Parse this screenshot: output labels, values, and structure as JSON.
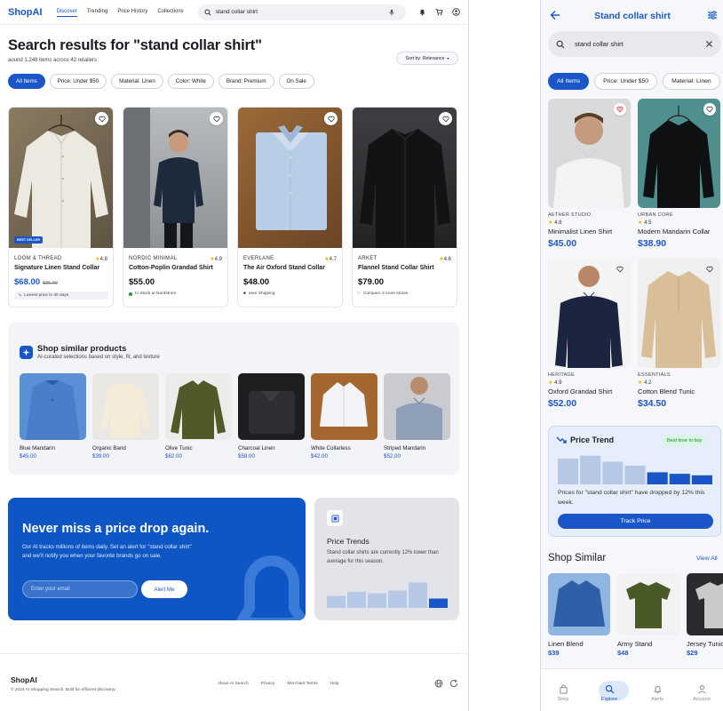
{
  "desktop": {
    "logo": "ShopAI",
    "nav": [
      "Discover",
      "Trending",
      "Price History",
      "Collections"
    ],
    "search_value": "stand collar shirt",
    "page_title": "Search results for \"stand collar shirt\"",
    "subtitle": "aound 1,248 items across 42 retailers",
    "sort_label": "Sort by: Relevance",
    "chips": [
      "All Items",
      "Price: Under $50",
      "Material: Linen",
      "Color: White",
      "Brand: Premium",
      "On Sale"
    ],
    "products": [
      {
        "brand": "LOOM & THREAD",
        "rating": "4.8",
        "name": "Signature Linen Stand Collar",
        "price": "$68.00",
        "old_price": "$85.00",
        "badge": "BEST SELLER",
        "note": "Lowest price in 30 days"
      },
      {
        "brand": "NORDIC MINIMAL",
        "rating": "4.9",
        "name": "Cotton-Poplin Grandad Shirt",
        "price": "$55.00",
        "note": "In Stock at Nordstrom"
      },
      {
        "brand": "EVERLANE",
        "rating": "4.7",
        "name": "The Air Oxford Stand Collar",
        "price": "$48.00",
        "note": "aree Shipping"
      },
      {
        "brand": "ARKET",
        "rating": "4.6",
        "name": "Flannel Stand Collar Shirt",
        "price": "$79.00",
        "note": "Compare 3 more stores"
      }
    ],
    "similar": {
      "title": "Shop similar products",
      "subtitle": "AI-curated selections based on style, fit, and texture",
      "items": [
        {
          "name": "Blue Mandarin",
          "price": "$45.00"
        },
        {
          "name": "Organic Band",
          "price": "$39.00"
        },
        {
          "name": "Olive Tunic",
          "price": "$62.00"
        },
        {
          "name": "Charcoal Linen",
          "price": "$58.00"
        },
        {
          "name": "White Collarless",
          "price": "$42.00"
        },
        {
          "name": "Striped Mandarin",
          "price": "$52.00"
        }
      ]
    },
    "alert": {
      "title": "Never miss a price drop again.",
      "body": "Our AI tracks millions of items daily. Set an alert for \"stand collar shirt\" and we'll notify you when your favorite brands go on sale.",
      "email_placeholder": "Enter your email",
      "button": "Alert Me"
    },
    "trends": {
      "title": "Price Trends",
      "body": "Stand collar shirts are currently 12% lower than average for this season.",
      "bars": [
        0.45,
        0.6,
        0.55,
        0.65,
        0.95,
        0.35
      ]
    },
    "footer": {
      "logo": "ShopAI",
      "copyright": "© 2024 AI Shopping Search. Built for efficient discovery.",
      "links": [
        "About AI Search",
        "Privacy",
        "Merchant Terms",
        "Help"
      ]
    }
  },
  "mobile": {
    "title": "Stand collar shirt",
    "search_value": "stand collar shirt",
    "chips": [
      "All Items",
      "Price: Under $50",
      "Material: Linen"
    ],
    "products": [
      {
        "brand": "AETHER STUDIO",
        "rating": "4.8",
        "name": "Minimalist Linen Shirt",
        "price": "$45.00"
      },
      {
        "brand": "URBAN CORE",
        "rating": "4.5",
        "name": "Modern Mandarin Collar",
        "price": "$38.90"
      },
      {
        "brand": "HERITAGE",
        "rating": "4.9",
        "name": "Oxford Grandad Shirt",
        "price": "$52.00"
      },
      {
        "brand": "ESSENTIALS",
        "rating": "4.2",
        "name": "Cotton Blend Tunic",
        "price": "$34.50"
      }
    ],
    "trend": {
      "title": "Price Trend",
      "badge": "Best time to buy",
      "body": "Prices for \"stand collar shirt\" have dropped by 12% this week.",
      "button": "Track Price",
      "bars": [
        0.85,
        0.95,
        0.75,
        0.62,
        0.4,
        0.35,
        0.3
      ]
    },
    "shop_similar": "Shop Similar",
    "view_all": "View All",
    "similar_items": [
      {
        "name": "Linen Blend",
        "price": "$39"
      },
      {
        "name": "Army Stand",
        "price": "$48"
      },
      {
        "name": "Jersey Tunic",
        "price": "$29"
      }
    ],
    "bottom_nav": [
      "Shop",
      "Explore",
      "Alerts",
      "Account"
    ]
  },
  "colors": {
    "accent": "#1b56c9",
    "alert_bg": "#0d56c4",
    "trend_bg": "#e6edfb",
    "badge_green": "#178a3f"
  }
}
